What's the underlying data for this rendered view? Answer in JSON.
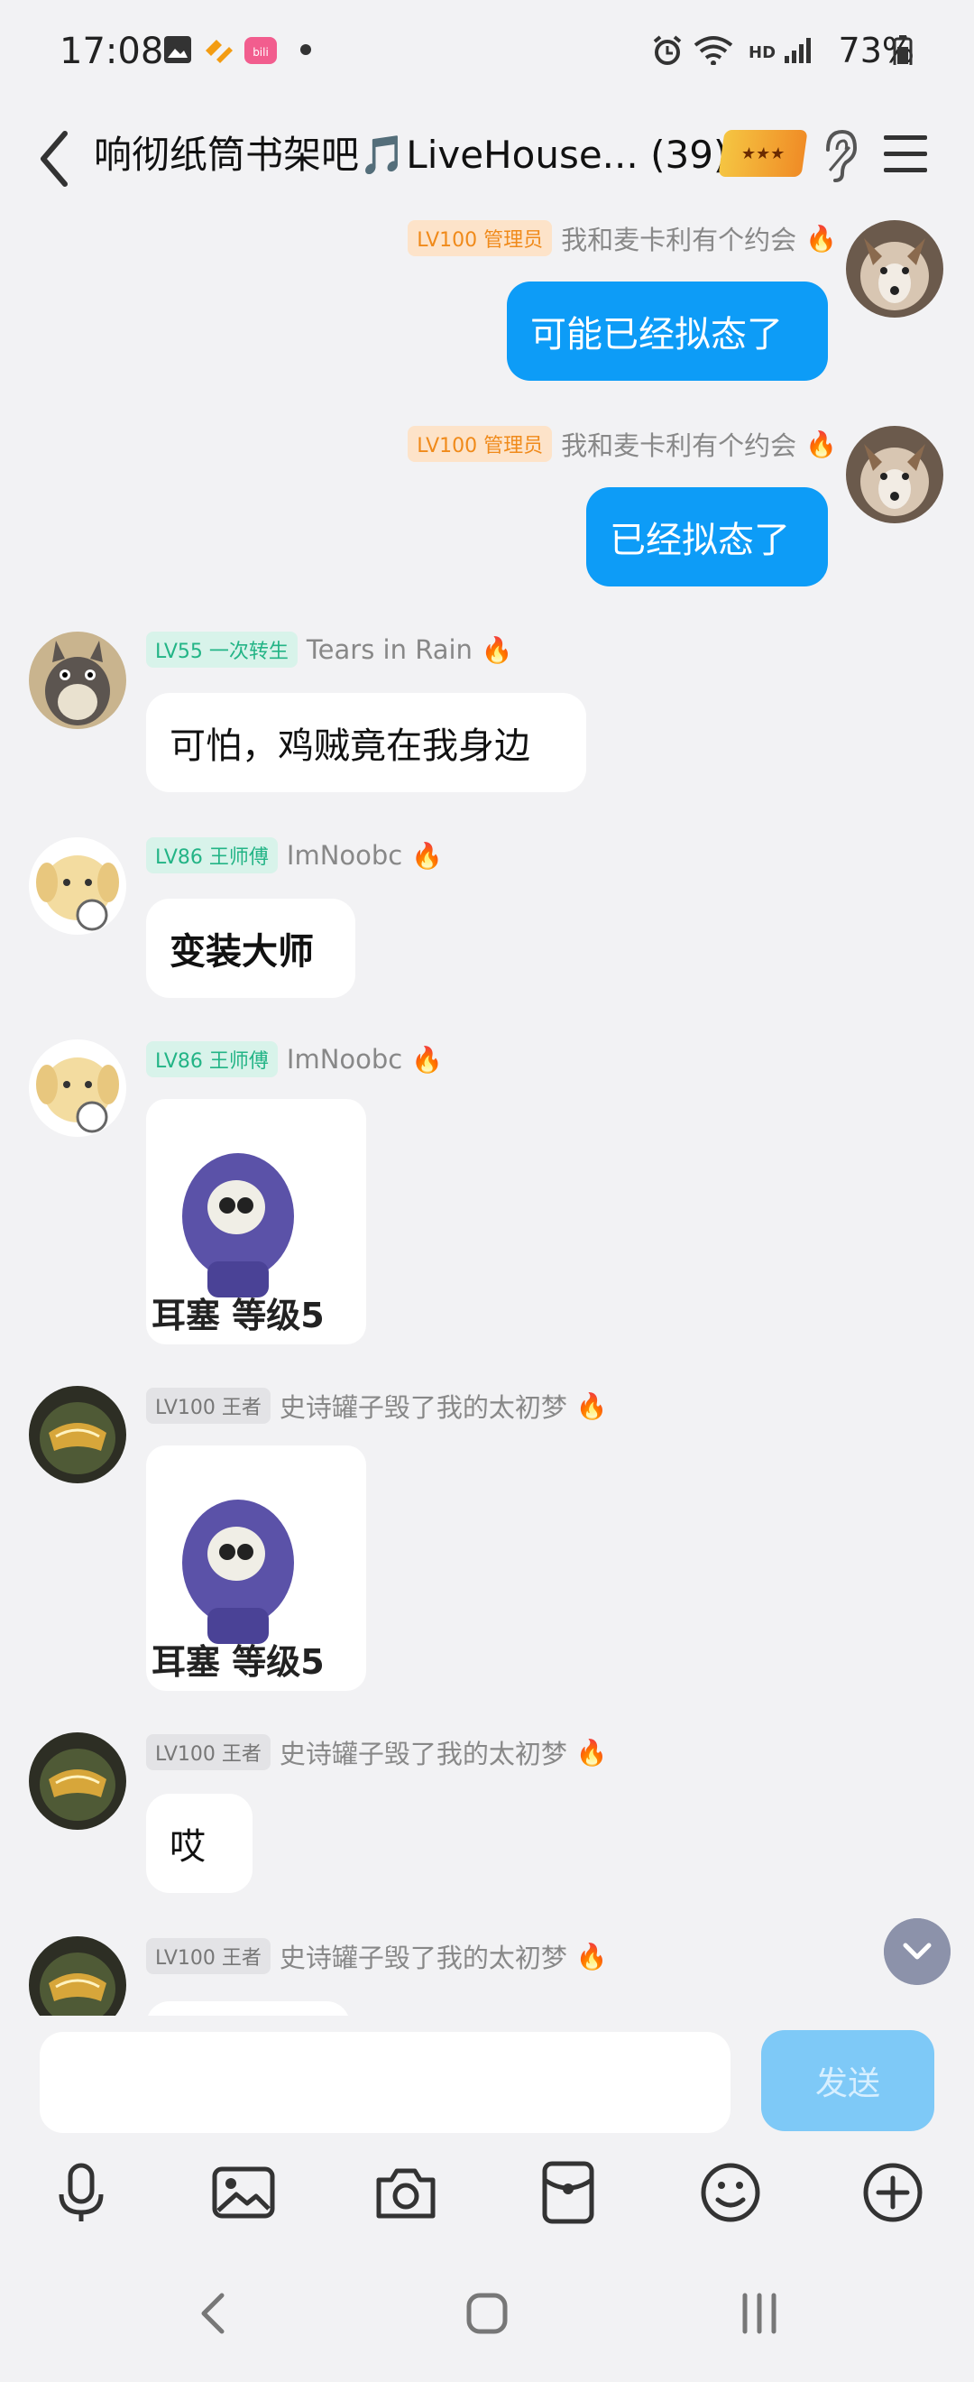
{
  "status": {
    "time": "17:08",
    "battery": "73%",
    "network": "HD"
  },
  "header": {
    "title": "响彻纸筒书架吧🎵LiveHouse...",
    "count": "(39)",
    "badge_icon": "honor-badge-icon"
  },
  "messages": [
    {
      "level": "LV100 管理员",
      "nick": "我和麦卡利有个约会",
      "text": "可能已经拟态了"
    },
    {
      "level": "LV100 管理员",
      "nick": "我和麦卡利有个约会",
      "text": "已经拟态了"
    },
    {
      "level": "LV55 一次转生",
      "nick": "Tears in Rain",
      "text": "可怕，鸡贼竟在我身边"
    },
    {
      "level": "LV86 王师傅",
      "nick": "ImNoobc",
      "text": "变装大师"
    },
    {
      "level": "LV86 王师傅",
      "nick": "ImNoobc",
      "sticker_caption": "耳塞 等级5"
    },
    {
      "level": "LV100 王者",
      "nick": "史诗罐子毁了我的太初梦",
      "sticker_caption": "耳塞 等级5"
    },
    {
      "level": "LV100 王者",
      "nick": "史诗罐子毁了我的太初梦",
      "text": "哎"
    },
    {
      "level": "LV100 王者",
      "nick": "史诗罐子毁了我的太初梦"
    }
  ],
  "input": {
    "send_label": "发送"
  },
  "colors": {
    "accent": "#0d9cf7",
    "send_disabled": "#7ec9f7",
    "background": "#f2f2f4"
  }
}
